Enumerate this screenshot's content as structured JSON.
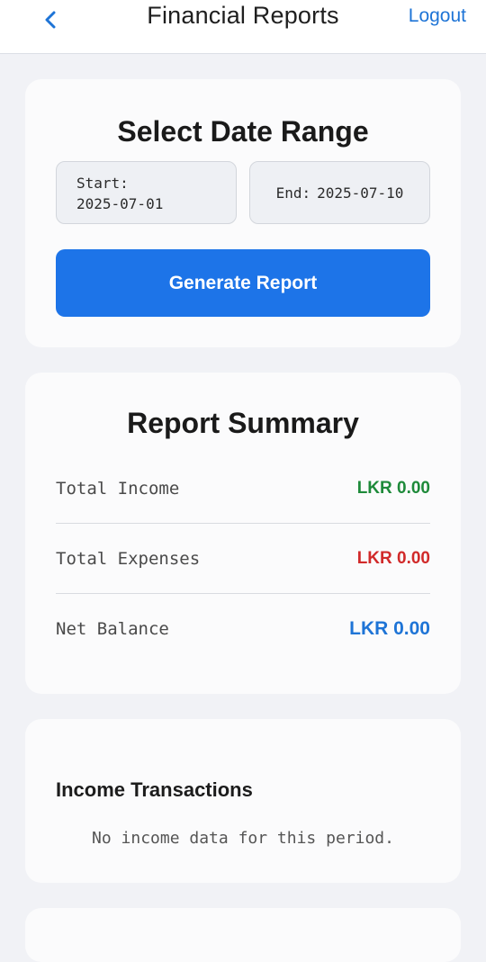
{
  "header": {
    "title": "Financial Reports",
    "logout_label": "Logout",
    "back_icon": "chevron-left-icon"
  },
  "date_range": {
    "heading": "Select Date Range",
    "start_label": "Start:",
    "start_value": "2025-07-01",
    "end_label": "End:",
    "end_value": "2025-07-10",
    "generate_label": "Generate Report"
  },
  "summary": {
    "heading": "Report Summary",
    "rows": [
      {
        "label": "Total Income",
        "value": "LKR 0.00",
        "color": "#1e8a3a"
      },
      {
        "label": "Total Expenses",
        "value": "LKR 0.00",
        "color": "#d12a2a"
      },
      {
        "label": "Net Balance",
        "value": "LKR 0.00",
        "color": "#1e74d6"
      }
    ]
  },
  "income": {
    "title": "Income Transactions",
    "empty_message": "No income data for this period."
  },
  "colors": {
    "accent": "#1d74e8",
    "background": "#f1f2f6",
    "card": "#fbfbfc"
  }
}
